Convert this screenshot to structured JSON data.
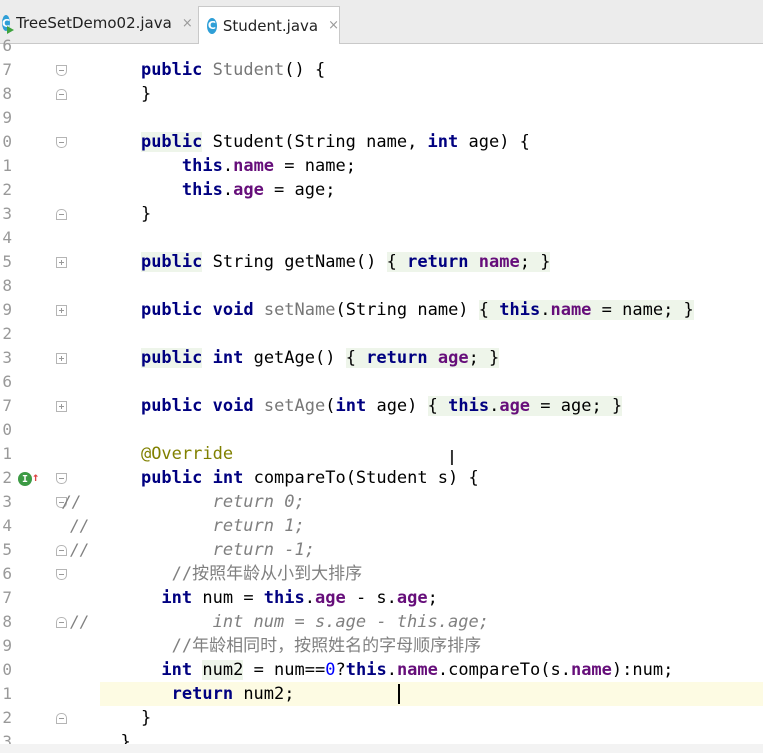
{
  "tabs": [
    {
      "label": "TreeSetDemo02.java",
      "close": "×",
      "active": false,
      "icon": "java-class-run-icon"
    },
    {
      "label": "Student.java",
      "close": "×",
      "active": true,
      "icon": "java-class-icon"
    }
  ],
  "gutter": {
    "line_numbers": [
      "6",
      "7",
      "8",
      "9",
      "0",
      "1",
      "2",
      "3",
      "4",
      "5",
      "8",
      "9",
      "2",
      "3",
      "6",
      "7",
      "0",
      "1",
      "2",
      "3",
      "4",
      "5",
      "6",
      "7",
      "8",
      "9",
      "0",
      "1",
      "2",
      "3"
    ],
    "comment_markers": [
      "//",
      "//",
      "//",
      "//"
    ]
  },
  "code": {
    "ctor1_sig": [
      "public",
      " ",
      "Student",
      "() {"
    ],
    "close_brace": "}",
    "ctor2_sig": [
      "public",
      " Student(String name, ",
      "int",
      " age) {"
    ],
    "ctor2_l1": [
      "this",
      ".",
      "name",
      " = name;"
    ],
    "ctor2_l2": [
      "this",
      ".",
      "age",
      " = age;"
    ],
    "getName": [
      "public",
      " String getName() ",
      "{ ",
      "return",
      " ",
      "name",
      "; }"
    ],
    "setName": [
      "public",
      " ",
      "void",
      " ",
      "setName",
      "(String name) ",
      "{ ",
      "this",
      ".",
      "name",
      " = name; }"
    ],
    "getAge": [
      "public",
      " ",
      "int",
      " getAge() ",
      "{ ",
      "return",
      " ",
      "age",
      "; }"
    ],
    "setAge": [
      "public",
      " ",
      "void",
      " ",
      "setAge",
      "(",
      "int",
      " age) ",
      "{ ",
      "this",
      ".",
      "age",
      " = age; }"
    ],
    "override": "@Override",
    "compareTo_sig": [
      "public",
      " ",
      "int",
      " compareTo(Student s) {"
    ],
    "c_ret0": "return 0;",
    "c_ret1": "return 1;",
    "c_retm1": "return -1;",
    "cmt_sort_age": "//按照年龄从小到大排序",
    "num_line": [
      "int",
      " num = ",
      "this",
      ".",
      "age",
      " - s.",
      "age",
      ";"
    ],
    "c_num_alt": "int num = s.age - this.age;",
    "cmt_sort_name": "//年龄相同时，按照姓名的字母顺序排序",
    "num2_line": [
      "int",
      " ",
      "num2",
      " = num==",
      "0",
      "?",
      "this",
      ".",
      "name",
      ".compareTo(s.",
      "name",
      "):num;"
    ],
    "return_line": [
      "return",
      " num2;"
    ],
    "close_method": "}",
    "close_class": "}"
  },
  "colors": {
    "keyword": "#000080",
    "field": "#660e7a",
    "comment": "#808080",
    "annotation": "#808000",
    "number": "#0000ff",
    "current_line": "#fdfbe3"
  }
}
